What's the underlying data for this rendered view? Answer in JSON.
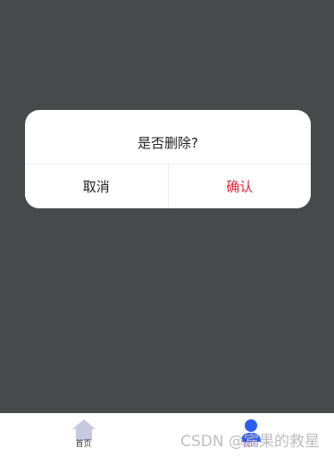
{
  "dialog": {
    "title": "是否删除?",
    "cancel_label": "取消",
    "confirm_label": "确认",
    "confirm_color": "#e8283c"
  },
  "tabbar": {
    "items": [
      {
        "label": "首页",
        "icon": "home-icon",
        "color": "#c8c9e0"
      },
      {
        "label": "我的",
        "icon": "user-icon",
        "color": "#2c5ef0"
      }
    ]
  },
  "watermark": "CSDN @宾果的救星",
  "colors": {
    "overlay": "#48494b",
    "active_tab_label": "#7a3fd6"
  }
}
